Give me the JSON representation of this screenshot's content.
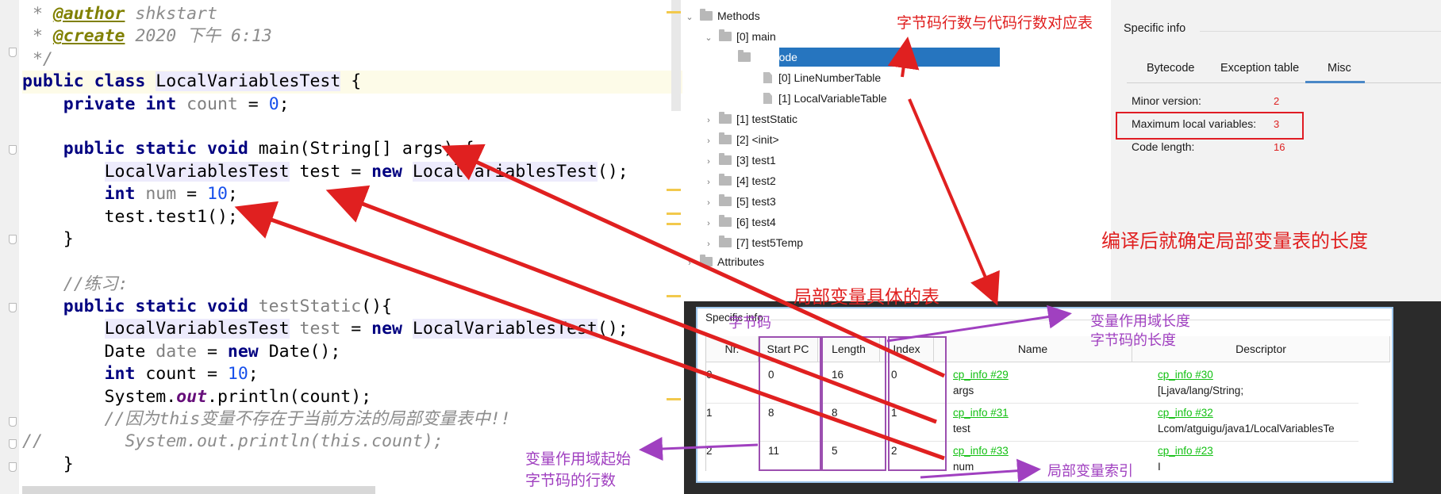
{
  "editor": {
    "lines": [
      [
        {
          "t": " * ",
          "c": "cm"
        },
        {
          "t": "@author",
          "c": "tag"
        },
        {
          "t": " shkstart",
          "c": "cm"
        }
      ],
      [
        {
          "t": " * ",
          "c": "cm"
        },
        {
          "t": "@create",
          "c": "tag"
        },
        {
          "t": " 2020 下午 6:13",
          "c": "cm"
        }
      ],
      [
        {
          "t": " */",
          "c": "cm"
        }
      ],
      [
        {
          "t": "public class ",
          "c": "kw"
        },
        {
          "t": "LocalVariablesTest",
          "c": "cls"
        },
        {
          "t": " {",
          "c": "pl"
        }
      ],
      [
        {
          "t": "    private int ",
          "c": "kw"
        },
        {
          "t": "count",
          "c": "unused"
        },
        {
          "t": " = ",
          "c": "pl"
        },
        {
          "t": "0",
          "c": "num"
        },
        {
          "t": ";",
          "c": "pl"
        }
      ],
      [
        {
          "t": "",
          "c": "pl"
        }
      ],
      [
        {
          "t": "    public static void ",
          "c": "kw"
        },
        {
          "t": "main(String[] args) {",
          "c": "pl"
        }
      ],
      [
        {
          "t": "        ",
          "c": "pl"
        },
        {
          "t": "LocalVariablesTest",
          "c": "cls"
        },
        {
          "t": " test = ",
          "c": "pl"
        },
        {
          "t": "new ",
          "c": "kw"
        },
        {
          "t": "LocalVariablesTest",
          "c": "cls"
        },
        {
          "t": "();",
          "c": "pl"
        }
      ],
      [
        {
          "t": "        ",
          "c": "pl"
        },
        {
          "t": "int ",
          "c": "kw"
        },
        {
          "t": "num",
          "c": "unused"
        },
        {
          "t": " = ",
          "c": "pl"
        },
        {
          "t": "10",
          "c": "num"
        },
        {
          "t": ";",
          "c": "pl"
        }
      ],
      [
        {
          "t": "        test.test1();",
          "c": "pl"
        }
      ],
      [
        {
          "t": "    }",
          "c": "pl"
        }
      ],
      [
        {
          "t": "",
          "c": "pl"
        }
      ],
      [
        {
          "t": "    //练习:",
          "c": "cm"
        }
      ],
      [
        {
          "t": "    public static void ",
          "c": "kw"
        },
        {
          "t": "testStatic",
          "c": "unused"
        },
        {
          "t": "(){",
          "c": "pl"
        }
      ],
      [
        {
          "t": "        ",
          "c": "pl"
        },
        {
          "t": "LocalVariablesTest",
          "c": "cls"
        },
        {
          "t": " ",
          "c": "pl"
        },
        {
          "t": "test",
          "c": "unused"
        },
        {
          "t": " = ",
          "c": "pl"
        },
        {
          "t": "new ",
          "c": "kw"
        },
        {
          "t": "LocalVariablesTest",
          "c": "cls"
        },
        {
          "t": "();",
          "c": "pl"
        }
      ],
      [
        {
          "t": "        Date ",
          "c": "pl"
        },
        {
          "t": "date",
          "c": "unused"
        },
        {
          "t": " = ",
          "c": "pl"
        },
        {
          "t": "new ",
          "c": "kw"
        },
        {
          "t": "Date();",
          "c": "pl"
        }
      ],
      [
        {
          "t": "        ",
          "c": "pl"
        },
        {
          "t": "int ",
          "c": "kw"
        },
        {
          "t": "count = ",
          "c": "pl"
        },
        {
          "t": "10",
          "c": "num"
        },
        {
          "t": ";",
          "c": "pl"
        }
      ],
      [
        {
          "t": "        System.",
          "c": "pl"
        },
        {
          "t": "out",
          "c": "field"
        },
        {
          "t": ".println(count);",
          "c": "pl"
        }
      ],
      [
        {
          "t": "        //因为this变量不存在于当前方法的局部变量表中!!",
          "c": "cm"
        }
      ],
      [
        {
          "t": "//        System.out.println(this.count);",
          "c": "cm"
        }
      ],
      [
        {
          "t": "    }",
          "c": "pl"
        }
      ]
    ]
  },
  "tree": {
    "methods": "Methods",
    "main": "[0] main",
    "code": "[0] Code",
    "line_number_table": "[0] LineNumberTable",
    "local_variable_table": "[1] LocalVariableTable",
    "others": [
      "[1] testStatic",
      "[2] <init>",
      "[3] test1",
      "[4] test2",
      "[5] test3",
      "[6] test4",
      "[7] test5Temp"
    ],
    "attributes": "Attributes"
  },
  "info": {
    "title": "Specific info",
    "tabs": [
      "Bytecode",
      "Exception table",
      "Misc"
    ],
    "active_tab": "Misc",
    "props": [
      {
        "label": "Minor version:",
        "value": "2"
      },
      {
        "label": "Maximum local variables:",
        "value": "3"
      },
      {
        "label": "Code length:",
        "value": "16"
      }
    ]
  },
  "lvt": {
    "title": "Specific info",
    "columns": [
      "Nr.",
      "Start PC",
      "Length",
      "Index",
      "Name",
      "Descriptor"
    ],
    "rows": [
      {
        "nr": "0",
        "start_pc": "0",
        "length": "16",
        "index": "0",
        "name_ref": "cp_info #29",
        "name": "args",
        "desc_ref": "cp_info #30",
        "desc": "[Ljava/lang/String;"
      },
      {
        "nr": "1",
        "start_pc": "8",
        "length": "8",
        "index": "1",
        "name_ref": "cp_info #31",
        "name": "test",
        "desc_ref": "cp_info #32",
        "desc": "Lcom/atguigu/java1/LocalVariablesTe"
      },
      {
        "nr": "2",
        "start_pc": "11",
        "length": "5",
        "index": "2",
        "name_ref": "cp_info #33",
        "name": "num",
        "desc_ref": "cp_info #23",
        "desc": "I"
      }
    ]
  },
  "annotations": {
    "bytecode_line_map": "字节码行数与代码行数对应表",
    "compile_length": "编译后就确定局部变量表的长度",
    "lvt_table": "局部变量具体的表",
    "bytecode_word": "字节码",
    "scope_length_1": "变量作用域长度",
    "scope_length_2": "字节码的长度",
    "scope_start_1": "变量作用域起始",
    "scope_start_2": "字节码的行数",
    "var_index": "局部变量索引"
  },
  "colors": {
    "annotation_red": "#e02020",
    "annotation_purple": "#a040c0",
    "selection_blue": "#2675bf",
    "link_green": "#12c012"
  }
}
